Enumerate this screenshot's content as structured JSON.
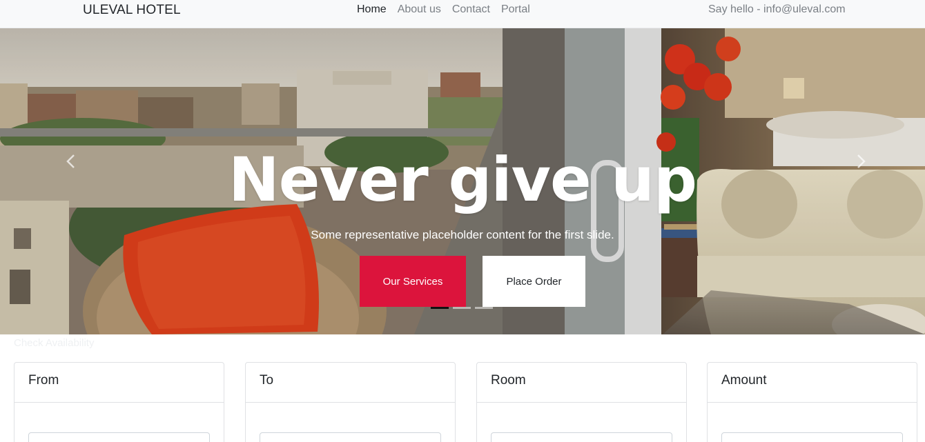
{
  "navbar": {
    "brand": "ULEVAL HOTEL",
    "links": [
      {
        "label": "Home",
        "active": true
      },
      {
        "label": "About us",
        "active": false
      },
      {
        "label": "Contact",
        "active": false
      },
      {
        "label": "Portal",
        "active": false
      }
    ],
    "contact_text": "Say hello - info@uleval.com"
  },
  "hero": {
    "title": "Never give up",
    "caption": "Some representative placeholder content for the first slide.",
    "primary_button": "Our Services",
    "secondary_button": "Place Order",
    "slide_count": 3,
    "active_slide": 1
  },
  "availability": {
    "label": "Check Availability",
    "cards": [
      {
        "title": "From",
        "value": ""
      },
      {
        "title": "To",
        "value": ""
      },
      {
        "title": "Room",
        "value": ""
      },
      {
        "title": "Amount",
        "value": ""
      }
    ]
  },
  "colors": {
    "accent": "#dc143c",
    "navbar_bg": "#f8f9fa",
    "nav_muted": "#7a7f85"
  },
  "icons": {
    "prev": "chevron-left-icon",
    "next": "chevron-right-icon"
  }
}
